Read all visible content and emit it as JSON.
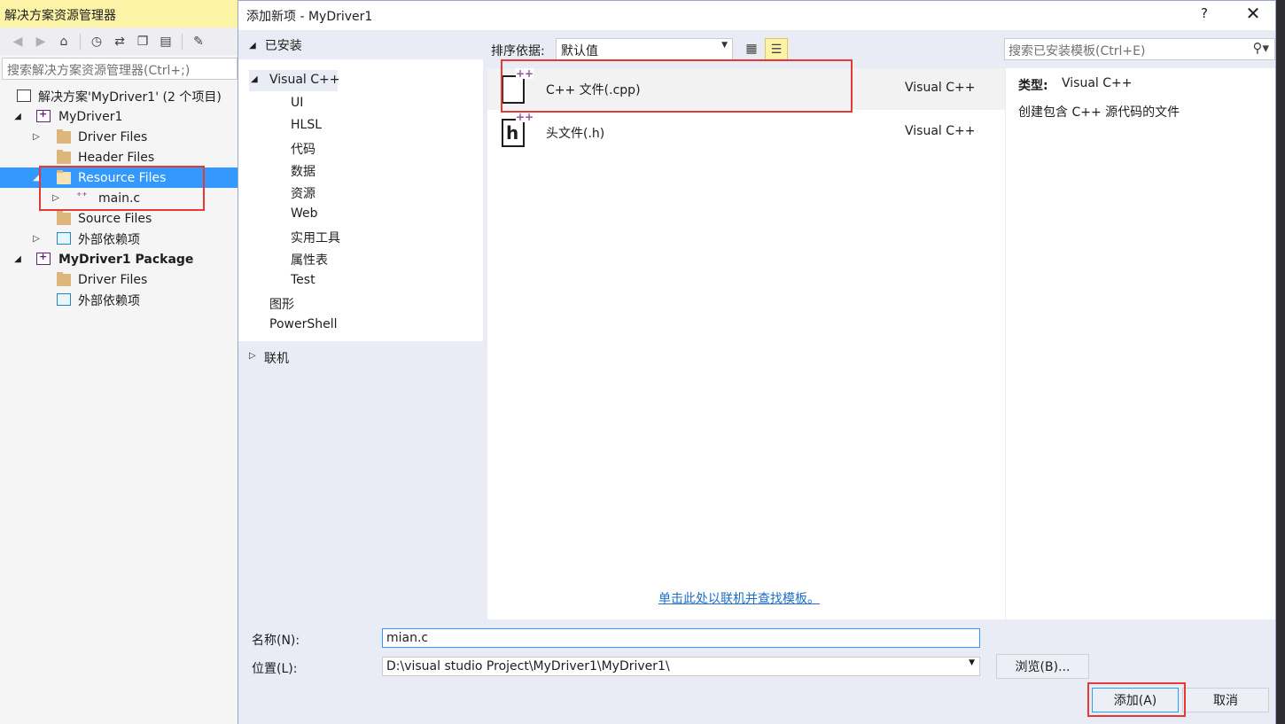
{
  "solution_explorer": {
    "title": "解决方案资源管理器",
    "search_placeholder": "搜索解决方案资源管理器(Ctrl+;)",
    "toolbar_icons": [
      "back-icon",
      "forward-icon",
      "home-icon",
      "history-icon",
      "sync-icon",
      "collapse-icon",
      "show-all-icon",
      "properties-icon"
    ],
    "tree": {
      "solution": "解决方案'MyDriver1' (2 个项目)",
      "project1": "MyDriver1",
      "driver_files": "Driver Files",
      "header_files": "Header Files",
      "resource_files": "Resource Files",
      "main_c": "main.c",
      "source_files": "Source Files",
      "external_deps": "外部依赖项",
      "project2": "MyDriver1 Package",
      "pkg_driver_files": "Driver Files",
      "pkg_external_deps": "外部依赖项"
    }
  },
  "dialog": {
    "title": "添加新项 - MyDriver1",
    "help": "?",
    "close": "✕",
    "installed_header": "已安装",
    "categories": {
      "visual_cpp": "Visual C++",
      "ui": "UI",
      "hlsl": "HLSL",
      "code": "代码",
      "data": "数据",
      "resource": "资源",
      "web": "Web",
      "utility": "实用工具",
      "property_sheet": "属性表",
      "test": "Test",
      "graphics": "图形",
      "powershell": "PowerShell"
    },
    "online": "联机",
    "sort_label": "排序依据:",
    "sort_value": "默认值",
    "search_placeholder": "搜索已安装模板(Ctrl+E)",
    "templates": [
      {
        "name": "C++ 文件(.cpp)",
        "type": "Visual C++",
        "icon": "cpp-file-icon"
      },
      {
        "name": "头文件(.h)",
        "type": "Visual C++",
        "icon": "header-file-icon"
      }
    ],
    "online_link": "单击此处以联机并查找模板。",
    "details": {
      "type_label": "类型:",
      "type_value": "Visual C++",
      "description": "创建包含 C++ 源代码的文件"
    },
    "name_label": "名称(N):",
    "name_value": "mian.c",
    "location_label": "位置(L):",
    "location_value": "D:\\visual studio Project\\MyDriver1\\MyDriver1\\",
    "browse_label": "浏览(B)...",
    "add_label": "添加(A)",
    "cancel_label": "取消"
  },
  "colors": {
    "selection": "#3399ff",
    "title_highlight": "#fdf3a6",
    "annotation_red": "#e53935",
    "link": "#1e6ec8"
  }
}
